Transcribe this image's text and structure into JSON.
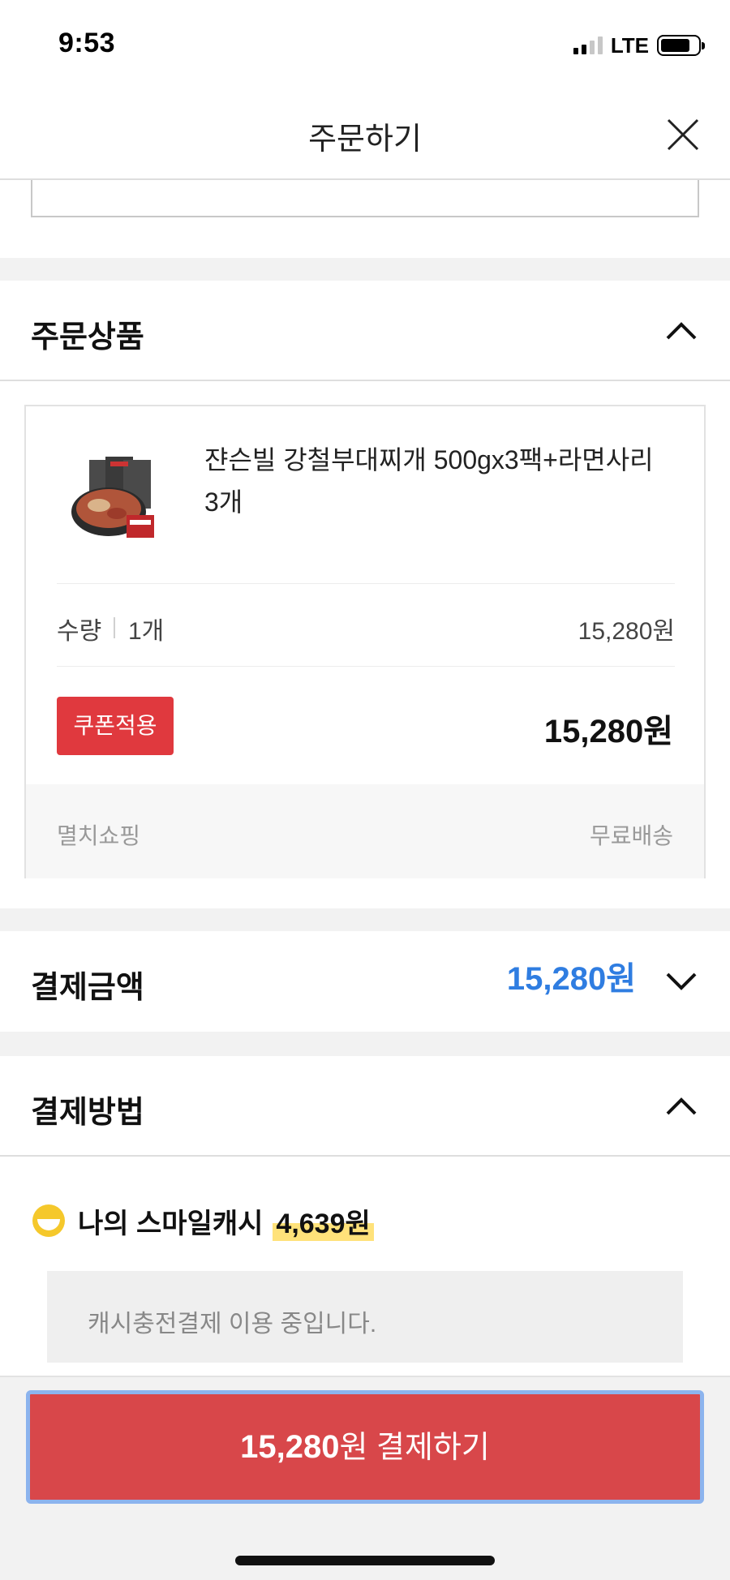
{
  "status_bar": {
    "time": "9:53",
    "network": "LTE"
  },
  "header": {
    "title": "주문하기"
  },
  "order_items": {
    "title": "주문상품",
    "product": {
      "name": "쟌슨빌 강철부대찌개 500gx3팩+라면사리 3개",
      "quantity_label": "수량",
      "quantity_value": "1개",
      "unit_price": "15,280원",
      "coupon_label": "쿠폰적용",
      "total": "15,280원",
      "shop": "멸치쇼핑",
      "shipping": "무료배송"
    }
  },
  "payment_amount": {
    "title": "결제금액",
    "amount": "15,280원"
  },
  "payment_method": {
    "title": "결제방법",
    "smile_cash_label": "나의 스마일캐시",
    "smile_cash_amount": "4,639원",
    "notice": "캐시충전결제 이용 중입니다."
  },
  "pay_button": {
    "amount": "15,280",
    "suffix": "원 결제하기"
  },
  "colors": {
    "accent_red": "#e0393e",
    "amount_blue": "#2f7de1",
    "highlight_yellow": "#ffe27a"
  }
}
